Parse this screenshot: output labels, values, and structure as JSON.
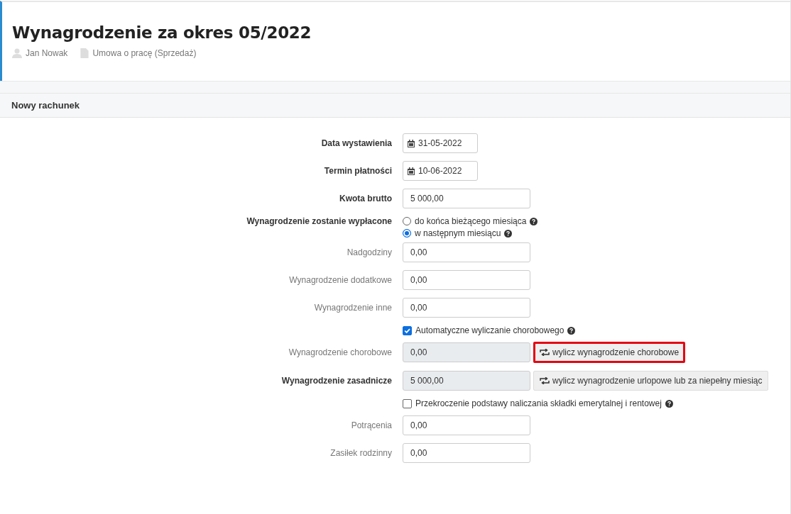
{
  "header": {
    "title": "Wynagrodzenie za okres 05/2022",
    "person": "Jan Nowak",
    "contract": "Umowa o pracę (Sprzedaż)"
  },
  "section": {
    "title": "Nowy rachunek"
  },
  "rows": [
    {
      "kind": "date",
      "label": "Data wystawienia",
      "bold": true,
      "value": "31-05-2022"
    },
    {
      "kind": "date",
      "label": "Termin płatności",
      "bold": true,
      "value": "10-06-2022"
    },
    {
      "kind": "input",
      "label": "Kwota brutto",
      "bold": true,
      "value": "5 000,00"
    },
    {
      "kind": "radio",
      "label": "Wynagrodzenie zostanie wypłacone",
      "bold": true,
      "options": [
        {
          "label": "do końca bieżącego miesiąca",
          "selected": false
        },
        {
          "label": "w następnym miesiącu",
          "selected": true
        }
      ]
    },
    {
      "kind": "input",
      "label": "Nadgodziny",
      "bold": false,
      "value": "0,00"
    },
    {
      "kind": "input",
      "label": "Wynagrodzenie dodatkowe",
      "bold": false,
      "value": "0,00"
    },
    {
      "kind": "input",
      "label": "Wynagrodzenie inne",
      "bold": false,
      "value": "0,00"
    },
    {
      "kind": "checkbox",
      "text": "Automatyczne wyliczanie chorobowego",
      "checked": true
    },
    {
      "kind": "readonly",
      "label": "Wynagrodzenie chorobowe",
      "bold": false,
      "value": "0,00",
      "button": "wylicz wynagrodzenie chorobowe",
      "highlighted": true
    },
    {
      "kind": "readonly",
      "label": "Wynagrodzenie zasadnicze",
      "bold": true,
      "value": "5 000,00",
      "button": "wylicz wynagrodzenie urlopowe lub za niepełny miesiąc",
      "highlighted": false
    },
    {
      "kind": "checkbox",
      "text": "Przekroczenie podstawy naliczania składki emerytalnej i rentowej",
      "checked": false
    },
    {
      "kind": "input",
      "label": "Potrącenia",
      "bold": false,
      "value": "0,00"
    },
    {
      "kind": "input",
      "label": "Zasiłek rodzinny",
      "bold": false,
      "value": "0,00"
    }
  ]
}
